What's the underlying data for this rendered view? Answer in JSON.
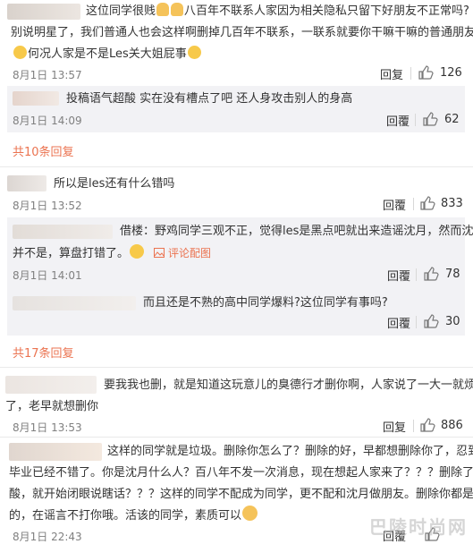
{
  "c1": {
    "line1": "这位同学很贱",
    "line1b": "八百年不联系人家因为相关隐私只留下好朋友不正常吗?",
    "line2": "别说明星了，我们普通人也会这样啊删掉几百年不联系，一联系就要你干嘛干嘛的普通朋友",
    "line3": "何况人家是不是Les关大姐屁事",
    "time": "8月1日 13:57",
    "reply": "回复",
    "likes": "126"
  },
  "c1_sub": {
    "text": "投稿语气超酸 实在没有槽点了吧 还人身攻击别人的身高",
    "time": "8月1日 14:09",
    "reply": "回覆",
    "likes": "62"
  },
  "c1_more": "共10条回复",
  "c2": {
    "text": "所以是les还有什么错吗",
    "time": "8月1日 13:52",
    "reply": "回覆",
    "likes": "833"
  },
  "c2_sub1": {
    "line1": "借楼：野鸡同学三观不正，觉得les是黑点吧就出来造谣沈月，然而沈月",
    "line2": "并不是，算盘打错了。",
    "report": "评论配图",
    "time": "8月1日 14:01",
    "reply": "回覆",
    "likes": "78"
  },
  "c2_sub2": {
    "text": "而且还是不熟的高中同学爆料?这位同学有事吗?",
    "reply": "回覆",
    "likes": "30"
  },
  "c2_more": "共17条回复",
  "c3": {
    "line1": "要我我也删，就是知道这玩意儿的臭德行才删你啊，人家说了一大一就烦你",
    "line2": "了，老早就想删你",
    "time": "8月1日 13:53",
    "reply": "回复",
    "likes": "886"
  },
  "c4": {
    "line1": "这样的同学就是垃圾。删除你怎么了？删除的好，早都想删除你了，忍到",
    "line2": "毕业已经不错了。你是沈月什么人？百八年不发一次消息，现在想起人家来了？？？删除了就",
    "line3": "酸，就开始闭眼说瞎话？？？这样的同学不配成为同学，更不配和沈月做朋友。删除你都是好",
    "line4": "的，在谣言不打你哦。活该的同学，素质可以",
    "time": "8月1日 22:43",
    "reply": "回覆"
  },
  "watermark": "巴陵时尚网",
  "colors": {
    "accent": "#eb7350",
    "sub_bg": "#f2f2f5",
    "meta": "#808080"
  },
  "icons": {
    "like": "thumbs-up-icon",
    "smile": "smile-emoji-icon",
    "report": "image-icon"
  }
}
